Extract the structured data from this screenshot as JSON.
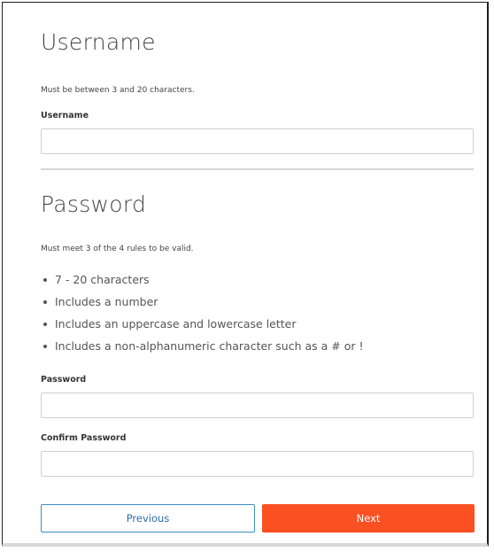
{
  "username_section": {
    "title": "Username",
    "hint": "Must be between 3 and 20 characters.",
    "field_label": "Username",
    "field_value": ""
  },
  "password_section": {
    "title": "Password",
    "hint": "Must meet 3 of the 4 rules to be valid.",
    "rules": [
      "7 - 20 characters",
      "Includes a number",
      "Includes an uppercase and lowercase letter",
      "Includes a non-alphanumeric character such as a # or !"
    ],
    "password_label": "Password",
    "password_value": "",
    "confirm_label": "Confirm Password",
    "confirm_value": ""
  },
  "buttons": {
    "previous_label": "Previous",
    "next_label": "Next"
  },
  "colors": {
    "primary_button": "#fb5022",
    "secondary_button_border": "#3a8fc4",
    "secondary_button_text": "#2c6fa8"
  }
}
